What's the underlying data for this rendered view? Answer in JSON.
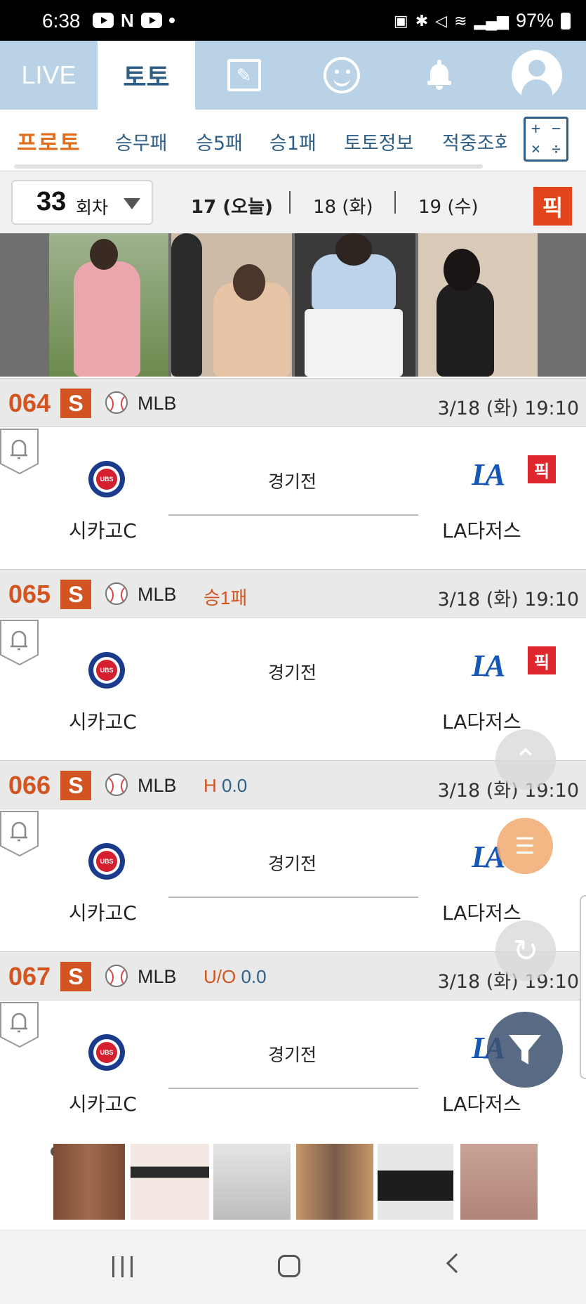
{
  "status_bar": {
    "time": "6:38",
    "battery": "97%",
    "icons": [
      "youtube-icon",
      "n-logo-icon",
      "youtube-icon",
      "dot-icon",
      "battery-saver-icon",
      "bluetooth-icon",
      "mute-icon",
      "wifi-icon",
      "signal-icon",
      "battery-icon"
    ]
  },
  "top_nav": {
    "live": "LIVE",
    "toto": "토토",
    "icons": [
      "edit-icon",
      "smiley-icon",
      "bell-icon",
      "profile-icon"
    ]
  },
  "sub_tabs": [
    "프로토",
    "승무패",
    "승5패",
    "승1패",
    "토토정보",
    "적중조회"
  ],
  "calc_symbols": [
    "+",
    "−",
    "×",
    "÷"
  ],
  "round": {
    "number": "33",
    "label": "회차",
    "dates": [
      "17 (오늘)",
      "18 (화)",
      "19 (수)"
    ],
    "pick": "픽"
  },
  "games": [
    {
      "num": "064",
      "badge": "S",
      "league": "MLB",
      "type": "",
      "value": "",
      "datetime": "3/18 (화)  19:10",
      "status": "경기전",
      "home": "시카고C",
      "away": "LA다저스",
      "away_logo": "LA",
      "pick": "픽"
    },
    {
      "num": "065",
      "badge": "S",
      "league": "MLB",
      "type": "승1패",
      "value": "",
      "datetime": "3/18 (화)  19:10",
      "status": "경기전",
      "home": "시카고C",
      "away": "LA다저스",
      "away_logo": "LA",
      "pick": "픽"
    },
    {
      "num": "066",
      "badge": "S",
      "league": "MLB",
      "type": "H",
      "value": "0.0",
      "datetime": "3/18 (화)  19:10",
      "status": "경기전",
      "home": "시카고C",
      "away": "LA다저스",
      "away_logo": "LA",
      "pick": ""
    },
    {
      "num": "067",
      "badge": "S",
      "league": "MLB",
      "type": "U/O",
      "value": "0.0",
      "datetime": "3/18 (화)  19:10",
      "status": "경기전",
      "home": "시카고C",
      "away": "LA다저스",
      "away_logo": "LA",
      "pick": ""
    }
  ],
  "floating": [
    "scroll-top-icon",
    "document-icon",
    "refresh-icon",
    "filter-icon"
  ],
  "colors": {
    "nav_bg": "#b9d2e6",
    "accent_orange": "#d25521",
    "link_blue": "#2f5f86",
    "pick_red": "#e2441b",
    "dodgers_blue": "#1657b8",
    "cubs_blue": "#1a3a8c",
    "cubs_red": "#d41f2f"
  }
}
